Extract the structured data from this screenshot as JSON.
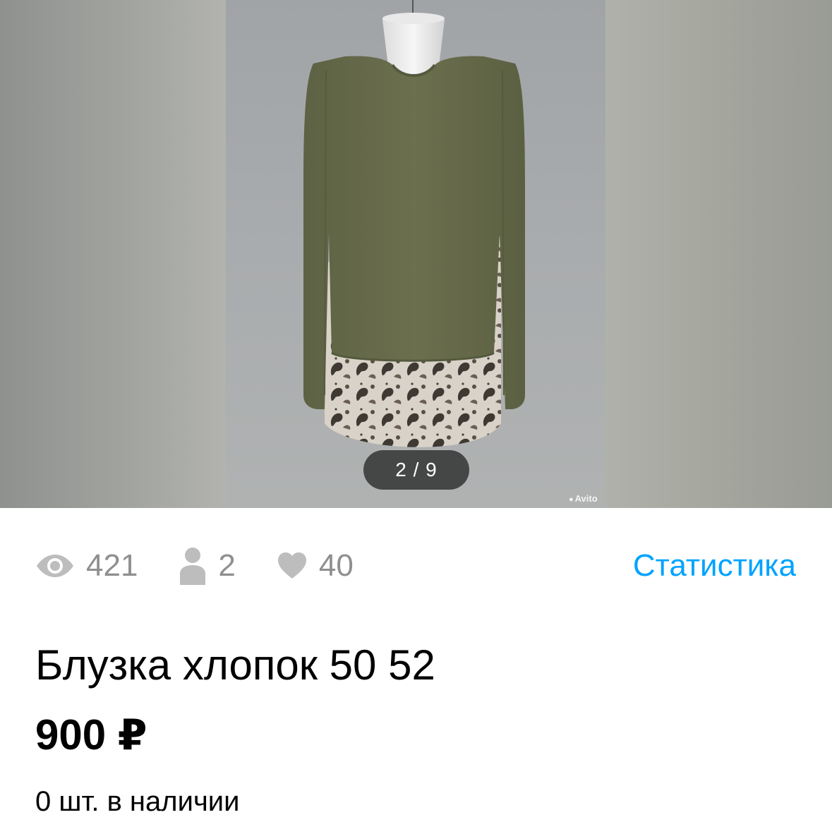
{
  "gallery": {
    "counter": "2 / 9",
    "watermark": "Avito",
    "photo_alt": "blouse-photo"
  },
  "stats": {
    "views": "421",
    "contacts": "2",
    "favorites": "40",
    "link_label": "Статистика",
    "icons": [
      "eye-icon",
      "person-icon",
      "heart-icon"
    ]
  },
  "listing": {
    "title": "Блузка хлопок 50 52",
    "price": "900 ₽",
    "stock": "0 шт. в наличии"
  },
  "colors": {
    "link": "#00a3ff",
    "stat_gray": "#8f8f8f",
    "text": "#000000"
  }
}
